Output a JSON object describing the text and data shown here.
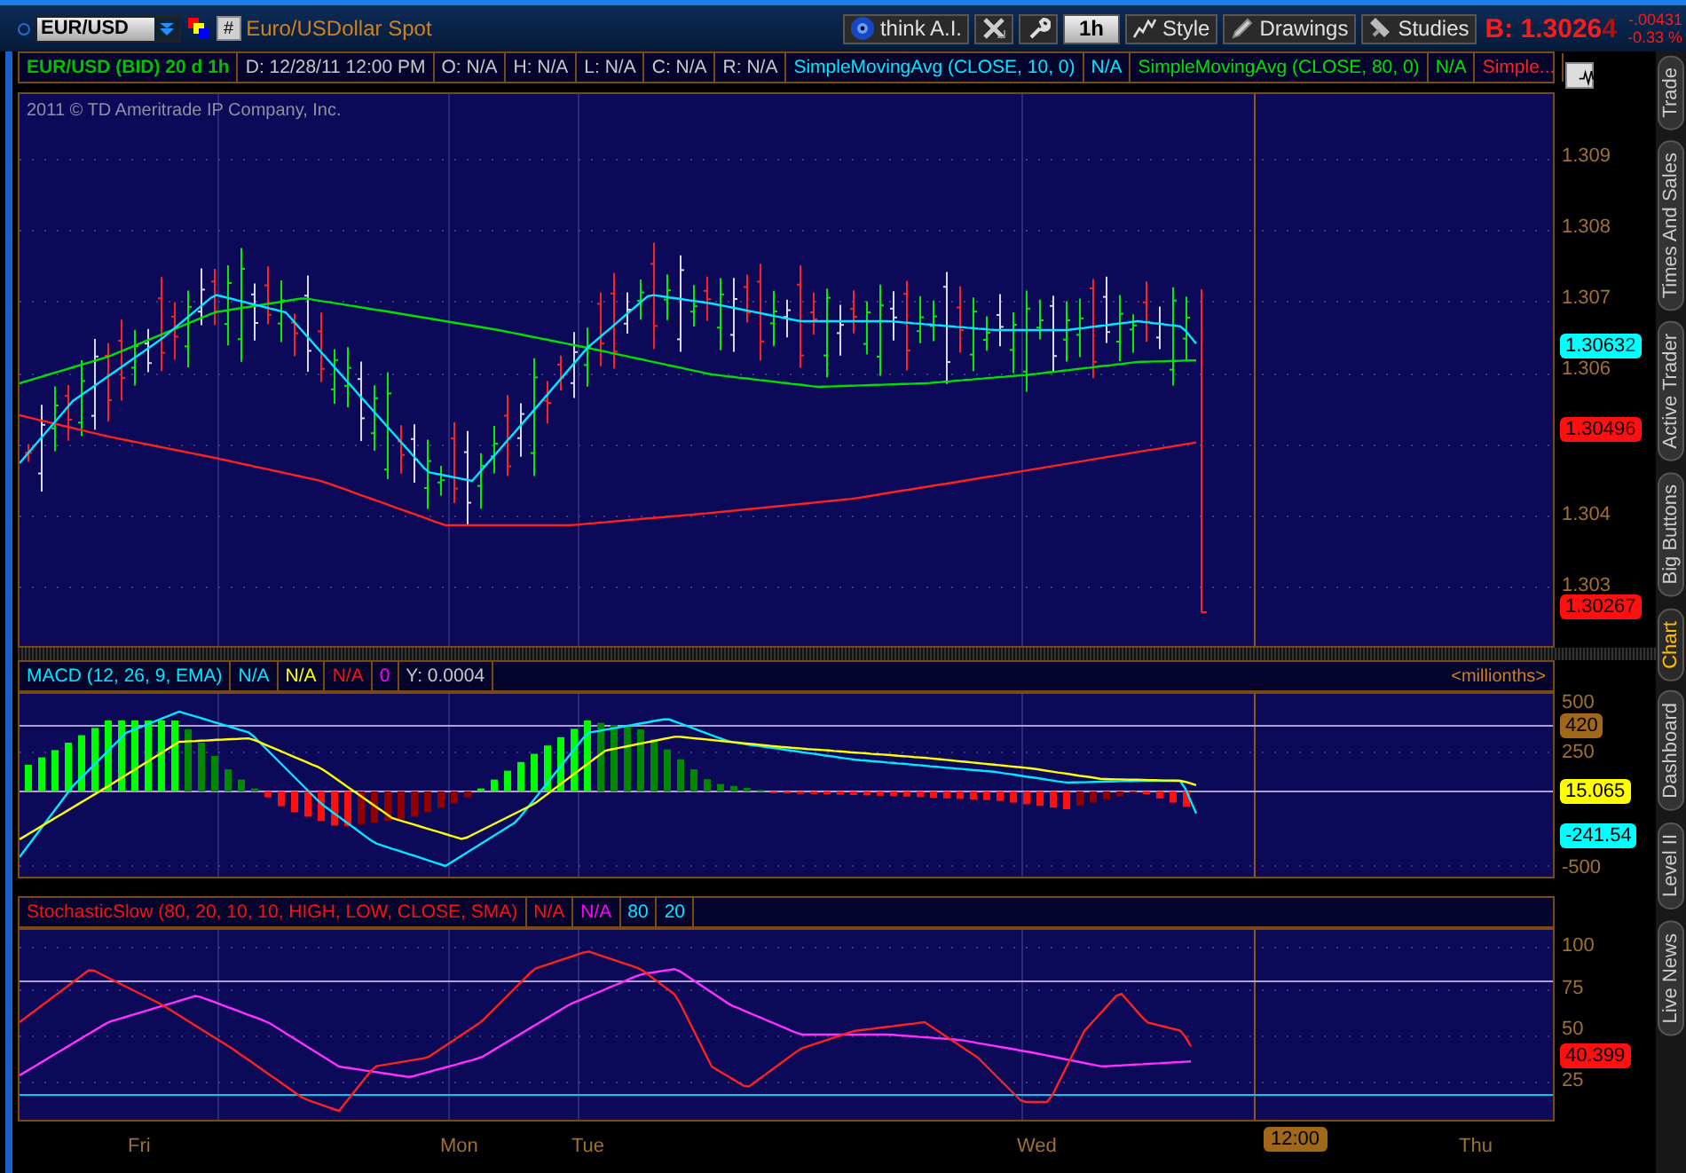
{
  "toolbar": {
    "symbol": "EUR/USD",
    "hash_button": "#",
    "description": "Euro/USDollar Spot",
    "buttons": [
      {
        "kind": "ai",
        "label": "think A.I."
      },
      {
        "kind": "tools"
      },
      {
        "kind": "wrench"
      },
      {
        "kind": "period",
        "label": "1h"
      },
      {
        "kind": "style",
        "label": "Style"
      },
      {
        "kind": "drawings",
        "label": "Drawings"
      },
      {
        "kind": "studies",
        "label": "Studies"
      }
    ],
    "quote": {
      "bid": "B: 1.3026",
      "bid_last_digit": "4",
      "change": "-.00431",
      "change_percent": "-0.33 %"
    }
  },
  "price_panel": {
    "header": [
      {
        "text": "EUR/USD (BID) 20 d 1h",
        "kind": "instrument"
      },
      {
        "text": "D: 12/28/11 12:00 PM",
        "kind": "info"
      },
      {
        "text": "O: N/A",
        "kind": "info"
      },
      {
        "text": "H: N/A",
        "kind": "info"
      },
      {
        "text": "L: N/A",
        "kind": "info"
      },
      {
        "text": "C: N/A",
        "kind": "info"
      },
      {
        "text": "R: N/A",
        "kind": "info"
      },
      {
        "text": "SimpleMovingAvg (CLOSE, 10, 0)",
        "kind": "plot_1"
      },
      {
        "text": "N/A",
        "kind": "plot_1"
      },
      {
        "text": "SimpleMovingAvg (CLOSE, 80, 0)",
        "kind": "plot_2"
      },
      {
        "text": "N/A",
        "kind": "plot_2"
      },
      {
        "text": "Simple...",
        "kind": "plot_3"
      }
    ],
    "copyright": "2011 © TD Ameritrade IP Company, Inc.",
    "y_labels": [
      "1.309",
      "1.308",
      "1.307",
      "1.306",
      "1.304",
      "1.303"
    ],
    "tags": [
      {
        "value": "1.3063",
        "last_digit": "2",
        "color": "#00ffff"
      },
      {
        "value": "1.3049",
        "last_digit": "6",
        "color": "#ff1010"
      },
      {
        "value": "1.3026",
        "last_digit": "7",
        "color": "#ff1010"
      }
    ]
  },
  "macd_panel": {
    "header": [
      {
        "text": "MACD (12, 26, 9, EMA)",
        "kind": "plot_1"
      },
      {
        "text": "N/A",
        "kind": "plot_1"
      },
      {
        "text": "N/A",
        "kind": "plot_2"
      },
      {
        "text": "N/A",
        "kind": "plot_3"
      },
      {
        "text": "0",
        "kind": "plot_4"
      },
      {
        "text": "Y: 0.0004",
        "kind": "info"
      }
    ],
    "units": "<millionths>",
    "y_labels": [
      "500",
      "250",
      "-500"
    ],
    "tags": [
      {
        "value": "420",
        "color": "#a06818"
      },
      {
        "value": "15.065",
        "color": "#ffff00"
      },
      {
        "value": "-241.54",
        "color": "#00ffff"
      }
    ]
  },
  "stochastic_panel": {
    "header": [
      {
        "text": "StochasticSlow (80, 20, 10, 10, HIGH, LOW, CLOSE, SMA)",
        "kind": "plot_1"
      },
      {
        "text": "N/A",
        "kind": "plot_1"
      },
      {
        "text": "N/A",
        "kind": "plot_2"
      },
      {
        "text": "80",
        "kind": "plot_3"
      },
      {
        "text": "20",
        "kind": "plot_3"
      }
    ],
    "y_labels": [
      "100",
      "75",
      "50",
      "25"
    ],
    "tags": [
      {
        "value": "40.399",
        "color": "#ff1010"
      }
    ]
  },
  "x_labels": [
    {
      "text": "Fri",
      "highlighted": false
    },
    {
      "text": "Mon",
      "highlighted": false
    },
    {
      "text": "Tue",
      "highlighted": false
    },
    {
      "text": "Wed",
      "highlighted": false
    },
    {
      "text": "12:00",
      "highlighted": true
    },
    {
      "text": "Thu",
      "highlighted": false
    }
  ],
  "side_tabs": [
    {
      "label": "Trade",
      "selected": false
    },
    {
      "label": "Times And Sales",
      "selected": false
    },
    {
      "label": "Active Trader",
      "selected": false
    },
    {
      "label": "Big Buttons",
      "selected": false
    },
    {
      "label": "Chart",
      "selected": true
    },
    {
      "label": "Dashboard",
      "selected": false
    },
    {
      "label": "Level II",
      "selected": false
    },
    {
      "label": "Live News",
      "selected": false
    }
  ]
}
